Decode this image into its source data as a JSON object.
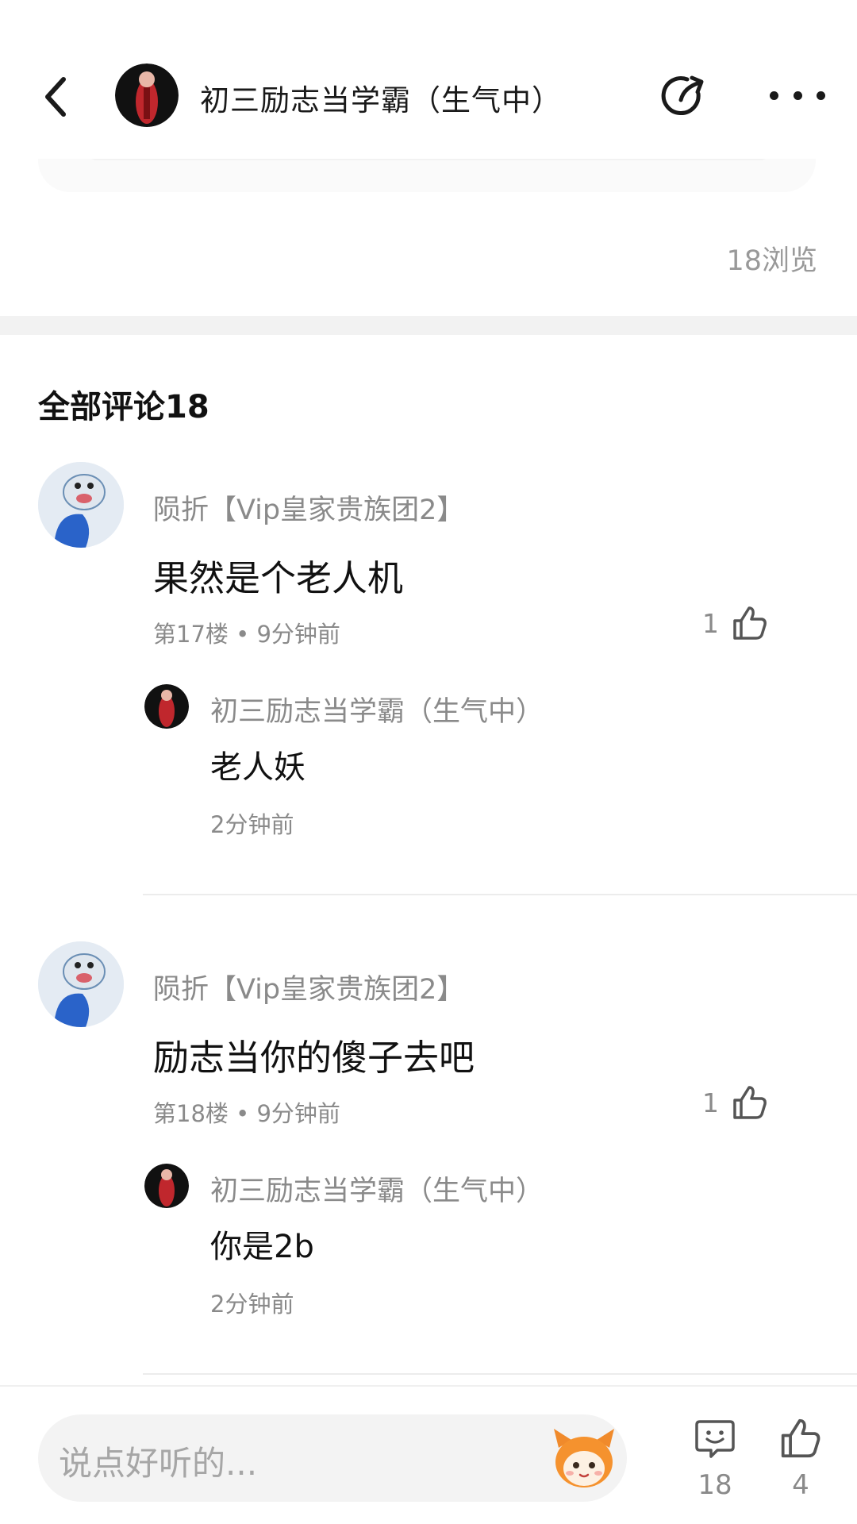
{
  "header": {
    "title": "初三励志当学霸（生气中）",
    "back_icon": "chevron-left-icon",
    "share_icon": "share-icon",
    "more_icon": "more-dots-icon"
  },
  "post": {
    "views": "18浏览"
  },
  "comments_section": {
    "title": "全部评论18"
  },
  "comments": [
    {
      "author": "陨折【Vip皇家贵族团2】",
      "text": "果然是个老人机",
      "meta": "第17楼 • 9分钟前",
      "likes": "1",
      "reply": {
        "author": "初三励志当学霸（生气中）",
        "text": "老人妖",
        "time": "2分钟前"
      }
    },
    {
      "author": "陨折【Vip皇家贵族团2】",
      "text": "励志当你的傻子去吧",
      "meta": "第18楼 • 9分钟前",
      "likes": "1",
      "reply": {
        "author": "初三励志当学霸（生气中）",
        "text": "你是2b",
        "time": "2分钟前"
      }
    }
  ],
  "bottom_bar": {
    "input_placeholder": "说点好听的...",
    "comment_count": "18",
    "like_count": "4"
  },
  "colors": {
    "accent_status": "#2fd3a8",
    "muted_text": "#8a8a8a",
    "divider": "#f2f2f2"
  }
}
